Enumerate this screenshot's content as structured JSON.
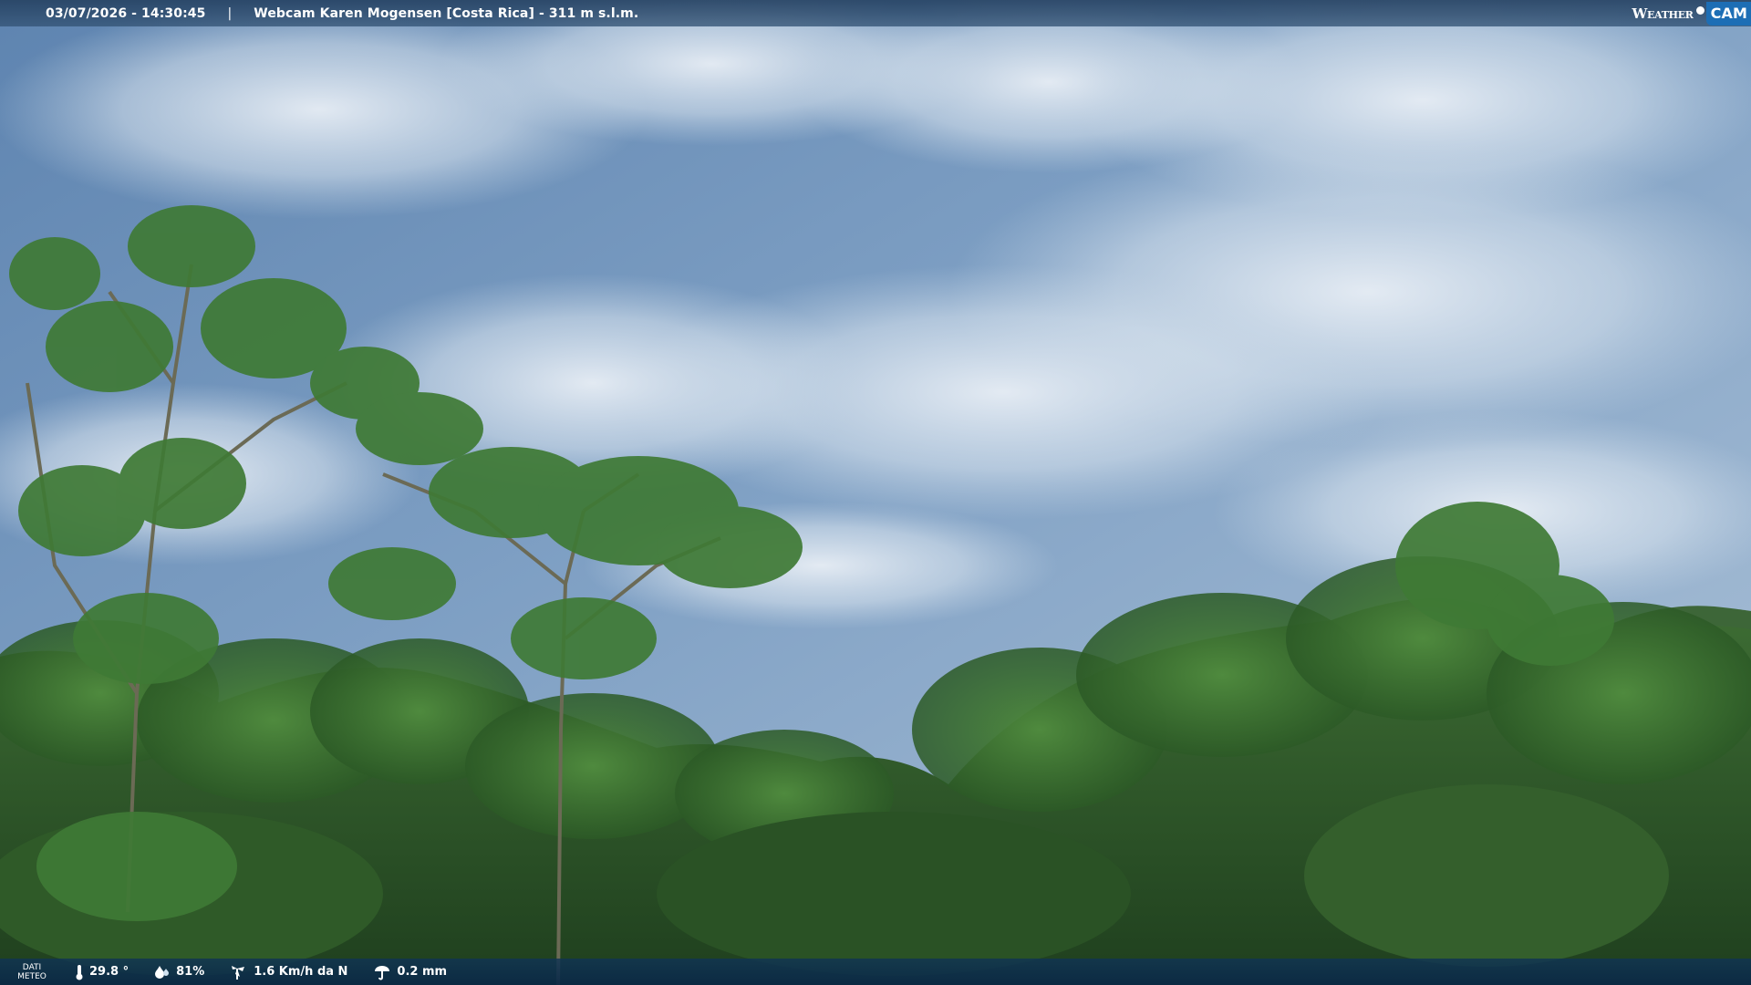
{
  "header": {
    "datetime": "03/07/2026 - 14:30:45",
    "separator": "|",
    "title": "Webcam Karen Mogensen [Costa Rica] - 311 m s.l.m."
  },
  "logo": {
    "weather_text": "Weather",
    "cam_text": "CAM",
    "accent_color": "#1d6eb5"
  },
  "meteo": {
    "label": "DATI METEO",
    "temperature": "29.8 °",
    "humidity": "81%",
    "wind": "1.6 Km/h da N",
    "rain": "0.2 mm",
    "icons": [
      "thermometer-icon",
      "humidity-icon",
      "wind-icon",
      "rain-icon"
    ]
  },
  "scene": {
    "sky_color": "#6d90b8",
    "forest_color": "#2f5a2a"
  }
}
